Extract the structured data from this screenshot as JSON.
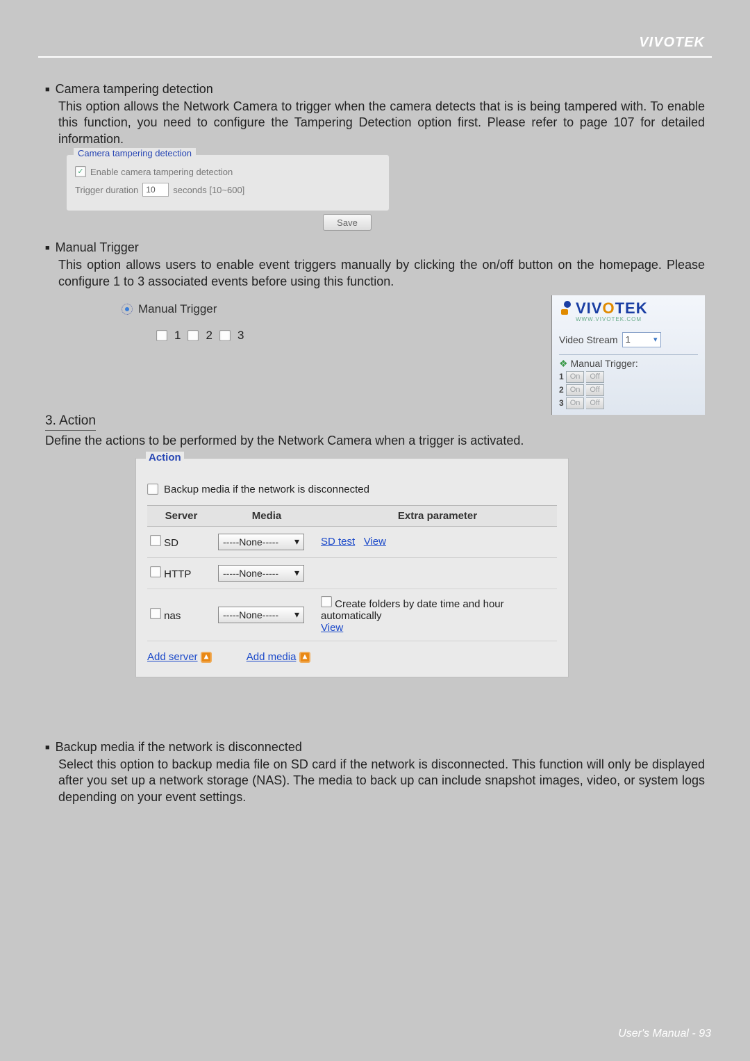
{
  "header": {
    "brand": "VIVOTEK"
  },
  "sec_tamper": {
    "title": "Camera tampering detection",
    "desc": "This option allows the Network Camera to trigger when the camera detects that is is being tampered with. To enable this function, you need to configure the Tampering Detection option first. Please refer to page 107 for detailed information.",
    "legend": "Camera tampering detection",
    "enable_label": "Enable camera tampering detection",
    "duration_label": "Trigger duration",
    "duration_value": "10",
    "duration_hint": "seconds [10~600]",
    "save": "Save"
  },
  "sec_manual": {
    "title": "Manual Trigger",
    "desc": "This option allows users to enable event triggers manually by clicking the on/off button on the homepage. Please configure 1 to 3 associated events before using this function.",
    "radio_label": "Manual Trigger",
    "n1": "1",
    "n2": "2",
    "n3": "3"
  },
  "vv": {
    "logo_main": "VIVOTEK",
    "logo_sub": "WWW.VIVOTEK.COM",
    "stream_label": "Video Stream",
    "stream_value": "1",
    "mt_title": "Manual Trigger:",
    "r1": "1",
    "r2": "2",
    "r3": "3",
    "on": "On",
    "off": "Off"
  },
  "sec3": {
    "heading": "3. Action",
    "desc": "Define the actions to be performed by the Network Camera when a trigger is activated."
  },
  "action": {
    "title": "Action",
    "backup": "Backup media if the network is disconnected",
    "th_server": "Server",
    "th_media": "Media",
    "th_extra": "Extra parameter",
    "none": "-----None-----",
    "row_sd": "SD",
    "row_http": "HTTP",
    "row_nas": "nas",
    "sdtest": "SD test",
    "view": "View",
    "nas_extra": "Create folders by date time and hour automatically",
    "add_server": "Add server",
    "add_media": "Add media"
  },
  "sec_backup": {
    "title": "Backup media if the network is disconnected",
    "desc": "Select this option to backup media file on SD card if the network is disconnected. This function will only be displayed after you set up a network storage (NAS). The media to back up can include snapshot images, video, or system logs depending on your event settings."
  },
  "footer": {
    "text": "User's Manual - ",
    "page": "93"
  }
}
